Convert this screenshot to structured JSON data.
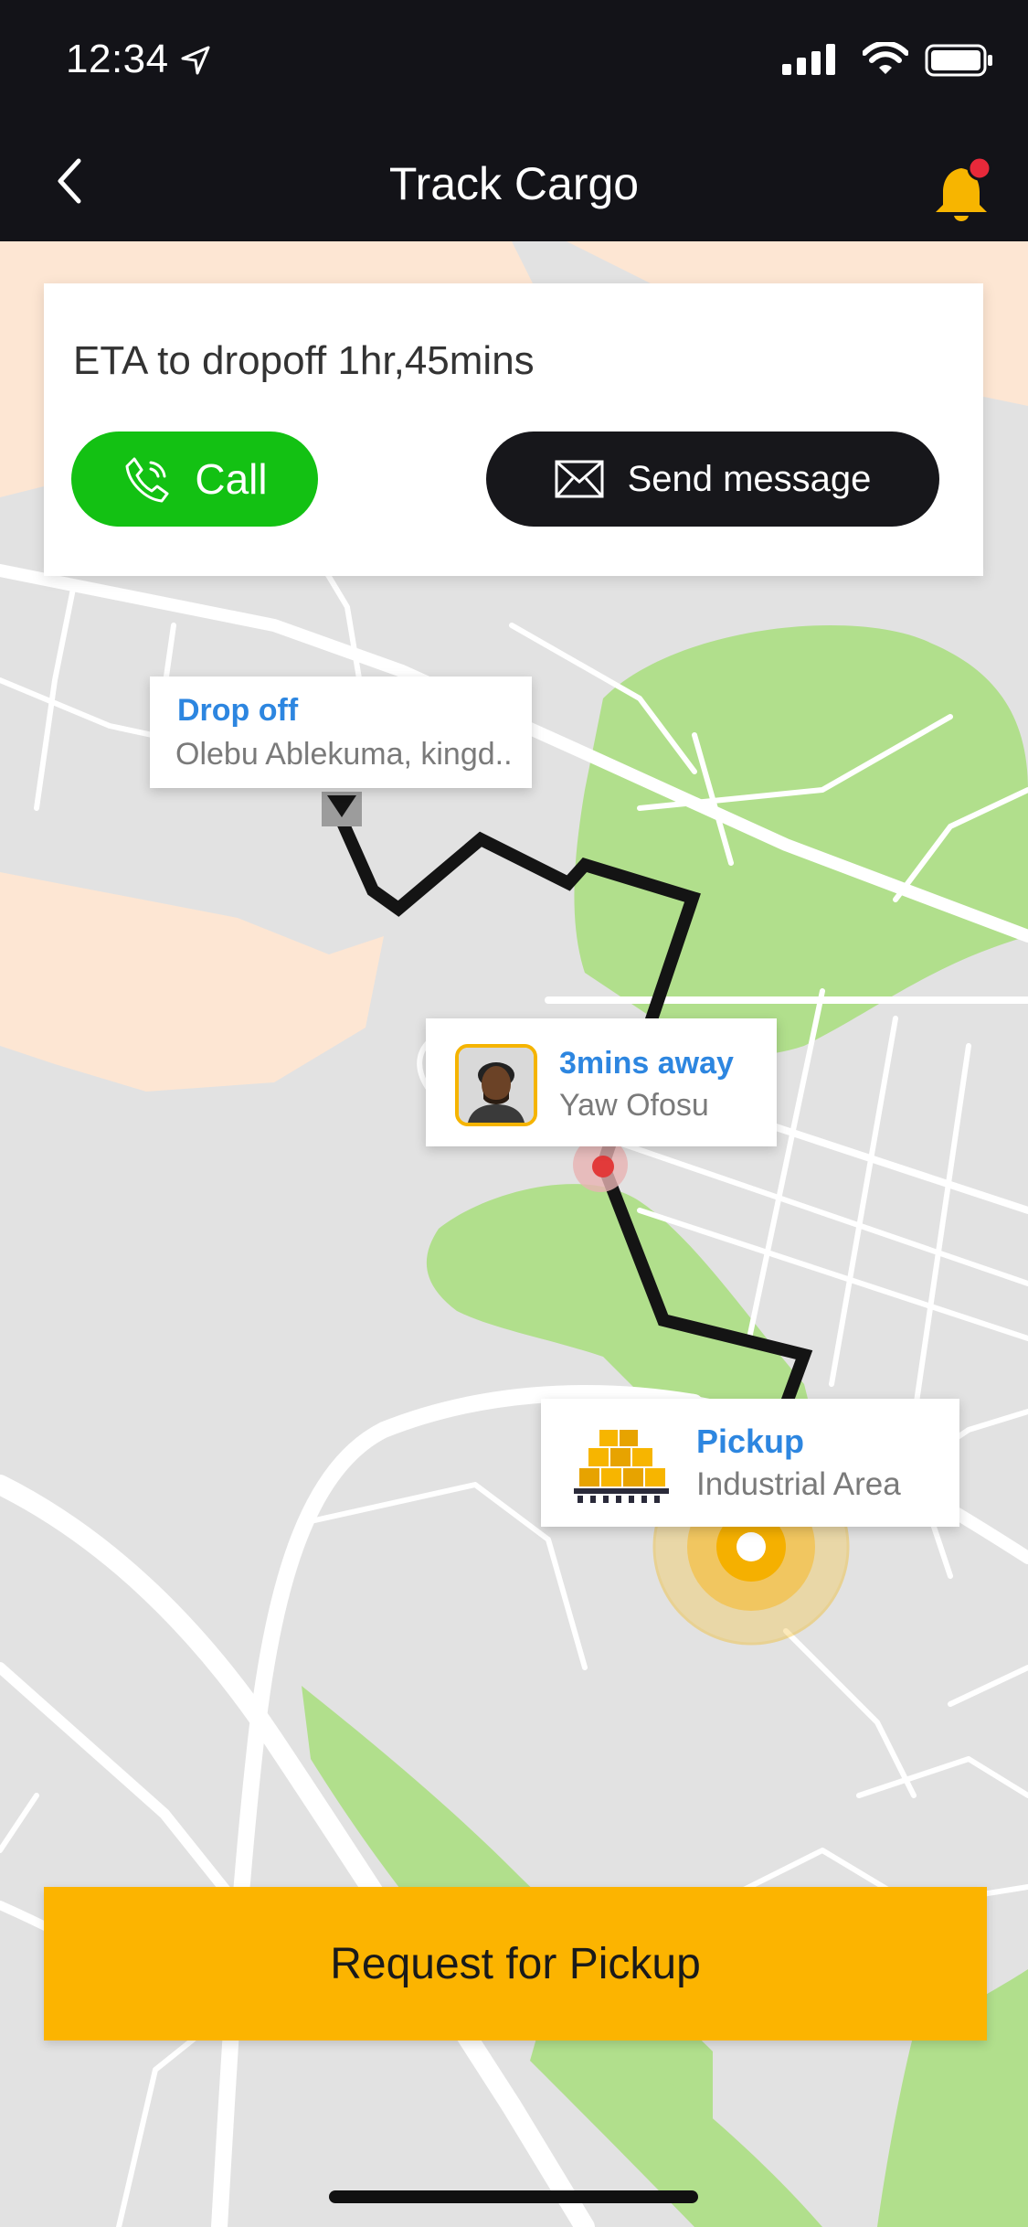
{
  "status_bar": {
    "time": "12:34",
    "icons": [
      "location-arrow-icon",
      "cellular-signal-icon",
      "wifi-icon",
      "battery-icon"
    ]
  },
  "nav": {
    "title": "Track Cargo",
    "back_icon": "chevron-left-icon",
    "bell_icon": "bell-icon",
    "has_notification": true
  },
  "eta_card": {
    "eta_text": "ETA to dropoff 1hr,45mins",
    "call_label": "Call",
    "message_label": "Send message",
    "call_icon": "phone-icon",
    "message_icon": "envelope-icon"
  },
  "map": {
    "dropoff": {
      "title": "Drop off",
      "address": "Olebu Ablekuma, kingd.."
    },
    "driver": {
      "eta": "3mins away",
      "name": "Yaw Ofosu"
    },
    "pickup": {
      "title": "Pickup",
      "area": "Industrial Area"
    }
  },
  "actions": {
    "request_pickup_label": "Request for Pickup"
  },
  "colors": {
    "header": "#131318",
    "accent_yellow": "#fcb400",
    "call_green": "#13c113",
    "link_blue": "#2d86e0",
    "route": "#141414"
  }
}
